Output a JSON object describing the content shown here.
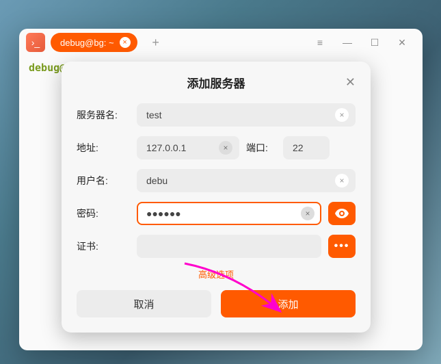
{
  "window": {
    "tab_label": "debug@bg: ~",
    "prompt": "debug@"
  },
  "dialog": {
    "title": "添加服务器",
    "server_label": "服务器名:",
    "server_value": "test",
    "addr_label": "地址:",
    "addr_value": "127.0.0.1",
    "port_label": "端口:",
    "port_value": "22",
    "user_label": "用户名:",
    "user_value": "debu",
    "pass_label": "密码:",
    "pass_value": "●●●●●●",
    "cert_label": "证书:",
    "cert_value": "",
    "adv_label": "高级选项",
    "cancel": "取消",
    "add": "添加"
  }
}
